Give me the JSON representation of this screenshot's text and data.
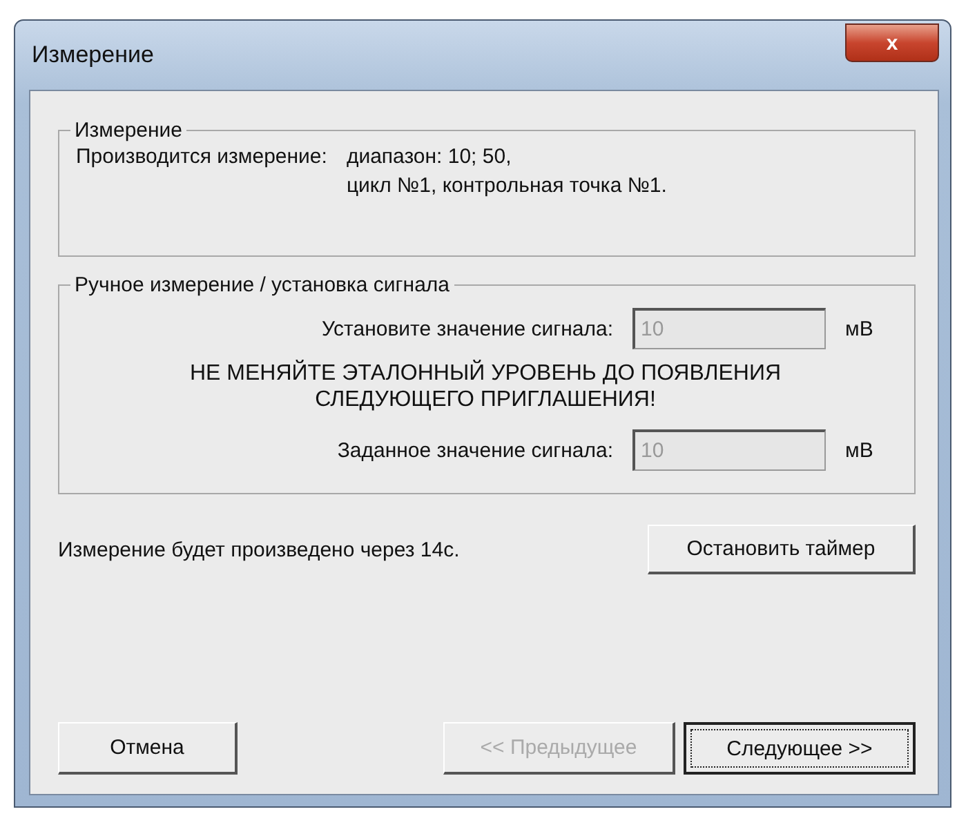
{
  "window": {
    "title": "Измерение",
    "close_label": "x"
  },
  "measurement_group": {
    "title": "Измерение",
    "label": "Производится измерение:",
    "lines": [
      "диапазон: 10; 50,",
      "цикл №1, контрольная точка №1."
    ]
  },
  "manual_group": {
    "title": "Ручное измерение / установка сигнала",
    "fields": [
      {
        "label": "Установите значение сигнала:",
        "value": "10",
        "unit": "мВ",
        "disabled": true
      }
    ],
    "warning": "НЕ МЕНЯЙТЕ ЭТАЛОННЫЙ УРОВЕНЬ ДО ПОЯВЛЕНИЯ СЛЕДУЮЩЕГО ПРИГЛАШЕНИЯ!",
    "fields_after": [
      {
        "label": "Заданное значение сигнала:",
        "value": "10",
        "unit": "мВ",
        "disabled": true
      }
    ]
  },
  "status": "Измерение будет произведено через 14с.",
  "timer_button": "Остановить таймер",
  "buttons": [
    {
      "label": "Отмена",
      "disabled": false,
      "default": false
    },
    {
      "label": "<< Предыдущее",
      "disabled": true,
      "default": false
    },
    {
      "label": "Следующее >>",
      "disabled": false,
      "default": true
    }
  ]
}
